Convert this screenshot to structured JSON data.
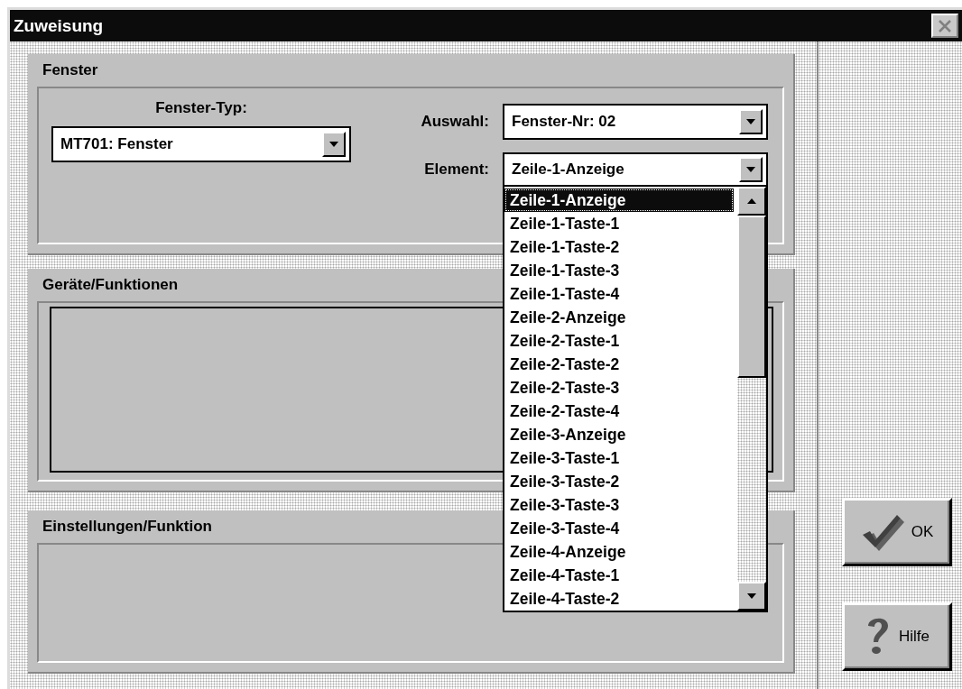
{
  "window": {
    "title": "Zuweisung"
  },
  "fenster": {
    "title": "Fenster",
    "fenster_typ": {
      "label": "Fenster-Typ:",
      "value": "MT701: Fenster"
    },
    "auswahl": {
      "label": "Auswahl:",
      "value": "Fenster-Nr: 02"
    },
    "element": {
      "label": "Element:",
      "value": "Zeile-1-Anzeige",
      "expanded": true,
      "options": [
        {
          "label": "Zeile-1-Anzeige",
          "selected": true
        },
        {
          "label": "Zeile-1-Taste-1",
          "selected": false
        },
        {
          "label": "Zeile-1-Taste-2",
          "selected": false
        },
        {
          "label": "Zeile-1-Taste-3",
          "selected": false
        },
        {
          "label": "Zeile-1-Taste-4",
          "selected": false
        },
        {
          "label": "Zeile-2-Anzeige",
          "selected": false
        },
        {
          "label": "Zeile-2-Taste-1",
          "selected": false
        },
        {
          "label": "Zeile-2-Taste-2",
          "selected": false
        },
        {
          "label": "Zeile-2-Taste-3",
          "selected": false
        },
        {
          "label": "Zeile-2-Taste-4",
          "selected": false
        },
        {
          "label": "Zeile-3-Anzeige",
          "selected": false
        },
        {
          "label": "Zeile-3-Taste-1",
          "selected": false
        },
        {
          "label": "Zeile-3-Taste-2",
          "selected": false
        },
        {
          "label": "Zeile-3-Taste-3",
          "selected": false
        },
        {
          "label": "Zeile-3-Taste-4",
          "selected": false
        },
        {
          "label": "Zeile-4-Anzeige",
          "selected": false
        },
        {
          "label": "Zeile-4-Taste-1",
          "selected": false
        },
        {
          "label": "Zeile-4-Taste-2",
          "selected": false
        }
      ]
    }
  },
  "geraete": {
    "title": "Geräte/Funktionen"
  },
  "einstellungen": {
    "title": "Einstellungen/Funktion"
  },
  "buttons": [
    {
      "label": "OK",
      "kind": "ok"
    },
    {
      "label": "Hilfe",
      "kind": "help"
    }
  ]
}
